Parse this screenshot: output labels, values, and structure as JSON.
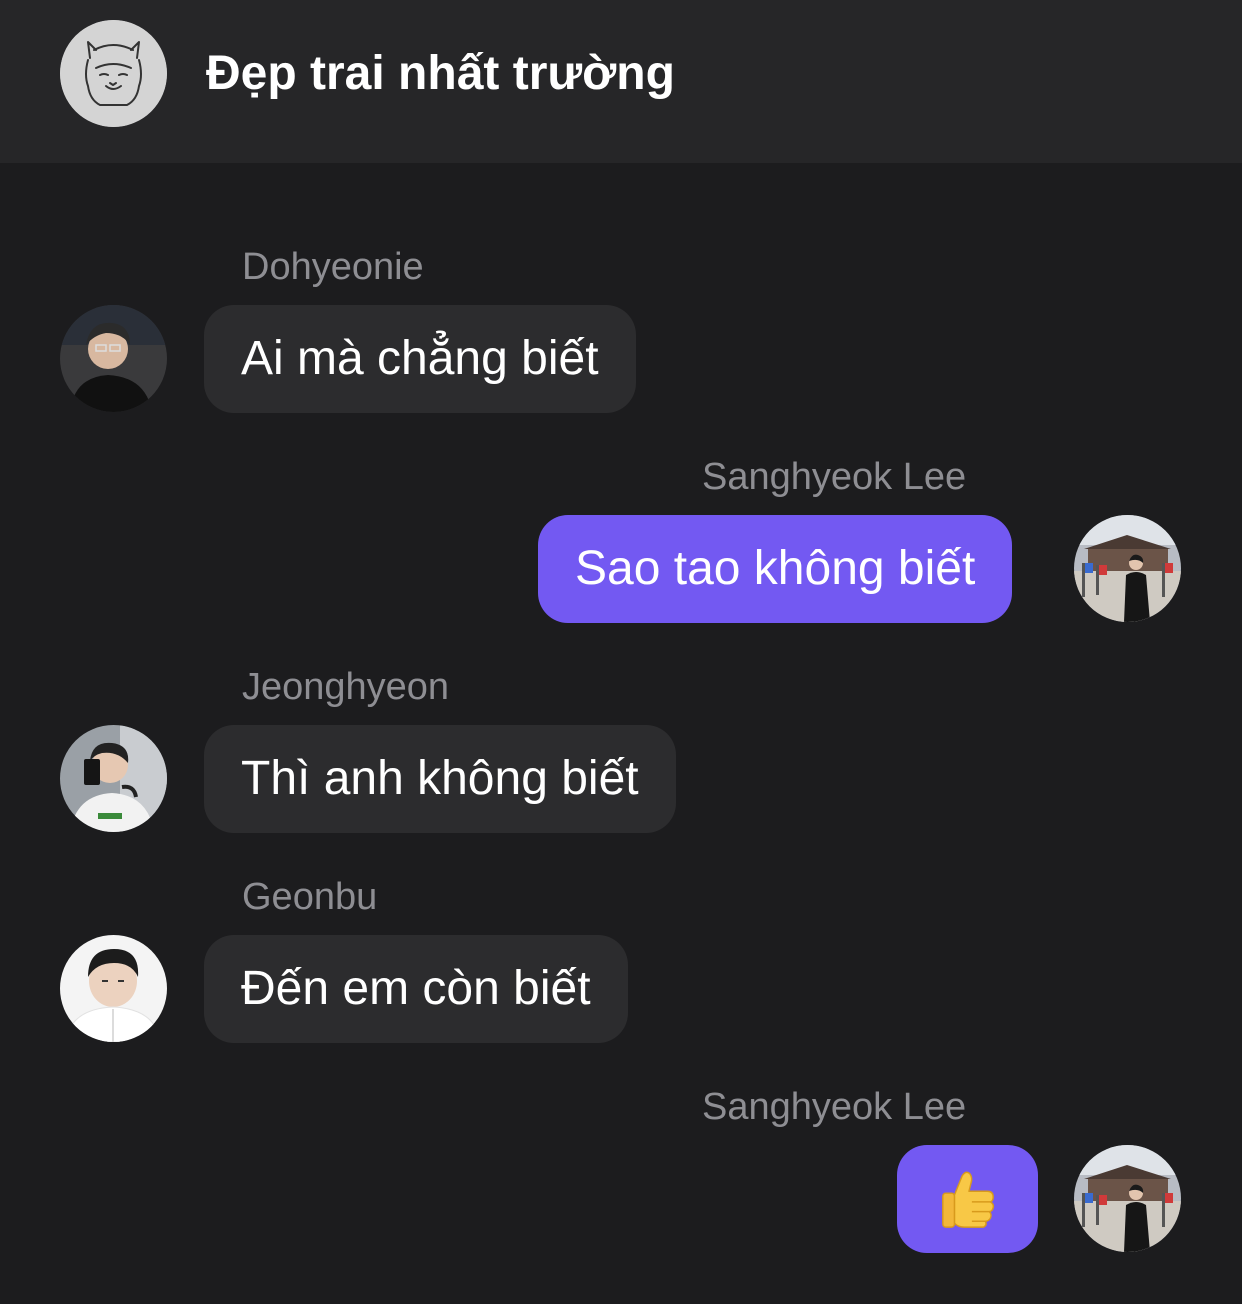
{
  "header": {
    "title": "Đẹp trai nhất trường",
    "avatar_icon": "alpaca-icon"
  },
  "messages": [
    {
      "sender": "Dohyeonie",
      "text": "Ai mà chẳng biết",
      "direction": "incoming"
    },
    {
      "sender": "Sanghyeok Lee",
      "text": "Sao tao không biết",
      "direction": "outgoing"
    },
    {
      "sender": "Jeonghyeon",
      "text": "Thì anh không biết",
      "direction": "incoming"
    },
    {
      "sender": "Geonbu",
      "text": "Đến em còn biết",
      "direction": "incoming"
    },
    {
      "sender": "Sanghyeok Lee",
      "text": "👍",
      "direction": "outgoing"
    }
  ],
  "colors": {
    "background": "#1c1c1e",
    "header_background": "#262628",
    "incoming_bubble": "#2c2c2e",
    "outgoing_bubble": "#7359f2",
    "sender_name": "#8e8e93"
  }
}
